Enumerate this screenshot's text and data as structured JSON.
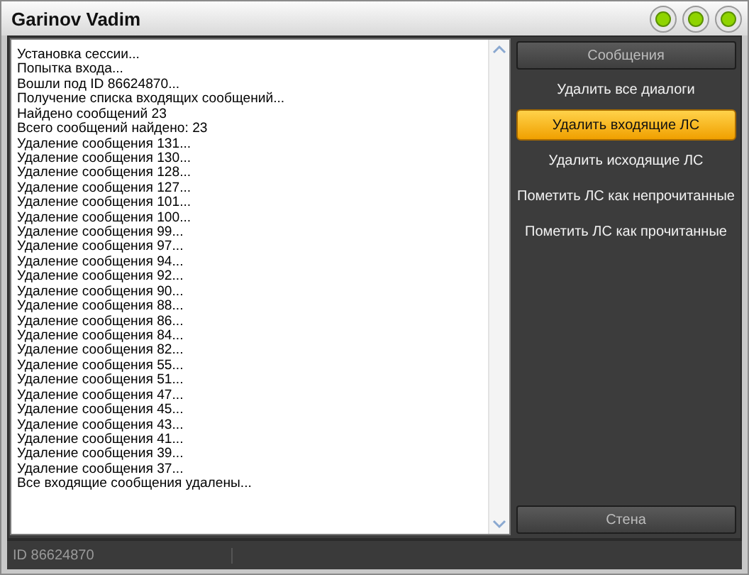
{
  "window": {
    "title": "Garinov Vadim"
  },
  "log": [
    "Установка сессии...",
    "Попытка входа...",
    "Вошли под ID 86624870...",
    "Получение списка входящих сообщений...",
    "Найдено сообщений 23",
    "Всего сообщений найдено: 23",
    "Удаление сообщения 131...",
    "Удаление сообщения 130...",
    "Удаление сообщения 128...",
    "Удаление сообщения 127...",
    "Удаление сообщения 101...",
    "Удаление сообщения 100...",
    "Удаление сообщения 99...",
    "Удаление сообщения 97...",
    "Удаление сообщения 94...",
    "Удаление сообщения 92...",
    "Удаление сообщения 90...",
    "Удаление сообщения 88...",
    "Удаление сообщения 86...",
    "Удаление сообщения 84...",
    "Удаление сообщения 82...",
    "Удаление сообщения 55...",
    "Удаление сообщения 51...",
    "Удаление сообщения 47...",
    "Удаление сообщения 45...",
    "Удаление сообщения 43...",
    "Удаление сообщения 41...",
    "Удаление сообщения 39...",
    "Удаление сообщения 37...",
    "Все входящие сообщения удалены..."
  ],
  "sidebar": {
    "header": "Сообщения",
    "items": [
      {
        "label": "Удалить все диалоги",
        "selected": false
      },
      {
        "label": "Удалить входящие ЛС",
        "selected": true
      },
      {
        "label": "Удалить исходящие ЛС",
        "selected": false
      },
      {
        "label": "Пометить ЛС как непрочитанные",
        "selected": false
      },
      {
        "label": "Пометить ЛС как прочитанные",
        "selected": false
      }
    ],
    "footer": "Стена"
  },
  "status_bar": {
    "text": "ID 86624870"
  }
}
